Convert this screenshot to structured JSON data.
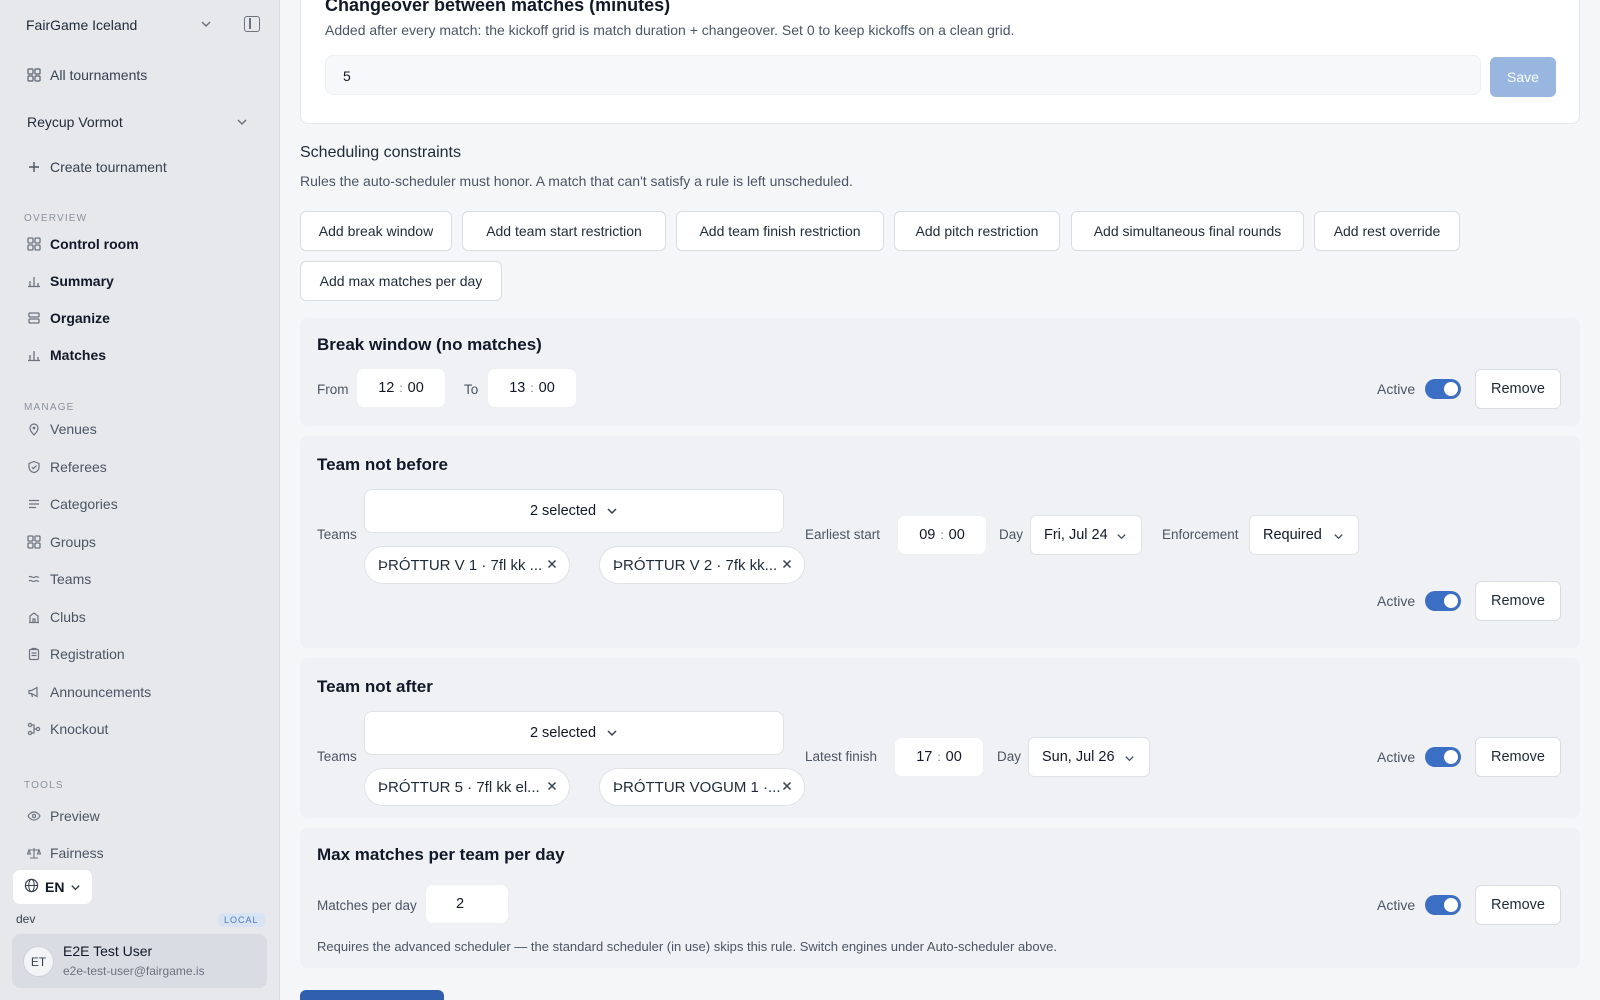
{
  "sidebar": {
    "org_name": "FairGame Iceland",
    "all_tournaments": "All tournaments",
    "tournament_name": "Reycup Vormot",
    "create_tournament": "Create tournament",
    "sections": {
      "overview": "OVERVIEW",
      "manage": "MANAGE",
      "tools": "TOOLS"
    },
    "overview_items": [
      {
        "label": "Control room",
        "icon": "grid-icon"
      },
      {
        "label": "Summary",
        "icon": "bar-chart-icon"
      },
      {
        "label": "Organize",
        "icon": "layers-icon"
      },
      {
        "label": "Matches",
        "icon": "bar-chart-icon"
      }
    ],
    "manage_items": [
      {
        "label": "Venues",
        "icon": "map-pin-icon"
      },
      {
        "label": "Referees",
        "icon": "shield-icon"
      },
      {
        "label": "Categories",
        "icon": "list-icon"
      },
      {
        "label": "Groups",
        "icon": "grid-icon"
      },
      {
        "label": "Teams",
        "icon": "users-icon"
      },
      {
        "label": "Clubs",
        "icon": "building-icon"
      },
      {
        "label": "Registration",
        "icon": "clipboard-icon"
      },
      {
        "label": "Announcements",
        "icon": "megaphone-icon"
      },
      {
        "label": "Knockout",
        "icon": "bracket-icon"
      }
    ],
    "tools_items": [
      {
        "label": "Preview",
        "icon": "eye-icon"
      },
      {
        "label": "Fairness",
        "icon": "scale-icon"
      }
    ],
    "language": "EN",
    "env": "dev",
    "env_badge": "LOCAL",
    "user": {
      "initials": "ET",
      "name": "E2E Test User",
      "email": "e2e-test-user@fairgame.is"
    }
  },
  "changeover": {
    "title": "Changeover between matches (minutes)",
    "description": "Added after every match: the kickoff grid is match duration + changeover. Set 0 to keep kickoffs on a clean grid.",
    "value": "5",
    "save_label": "Save"
  },
  "constraints": {
    "title": "Scheduling constraints",
    "description": "Rules the auto-scheduler must honor. A match that can't satisfy a rule is left unscheduled.",
    "add_buttons": [
      "Add break window",
      "Add team start restriction",
      "Add team finish restriction",
      "Add pitch restriction",
      "Add simultaneous final rounds",
      "Add rest override",
      "Add max matches per day"
    ]
  },
  "break_window": {
    "title": "Break window (no matches)",
    "from_label": "From",
    "from_h": "12",
    "from_m": "00",
    "to_label": "To",
    "to_h": "13",
    "to_m": "00",
    "active_label": "Active",
    "active": true,
    "remove_label": "Remove"
  },
  "team_not_before": {
    "title": "Team not before",
    "teams_label": "Teams",
    "selected": "2 selected",
    "chips": [
      "ÞRÓTTUR V 1 · 7fl kk ...",
      "ÞRÓTTUR V 2 · 7fk kk..."
    ],
    "earliest_label": "Earliest start",
    "time_h": "09",
    "time_m": "00",
    "day_label": "Day",
    "day": "Fri, Jul 24",
    "enforcement_label": "Enforcement",
    "enforcement": "Required",
    "active_label": "Active",
    "active": true,
    "remove_label": "Remove"
  },
  "team_not_after": {
    "title": "Team not after",
    "teams_label": "Teams",
    "selected": "2 selected",
    "chips": [
      "ÞRÓTTUR 5 · 7fl kk el...",
      "ÞRÓTTUR VOGUM 1 ·..."
    ],
    "latest_label": "Latest finish",
    "time_h": "17",
    "time_m": "00",
    "day_label": "Day",
    "day": "Sun, Jul 26",
    "active_label": "Active",
    "active": true,
    "remove_label": "Remove"
  },
  "max_matches": {
    "title": "Max matches per team per day",
    "per_day_label": "Matches per day",
    "value": "2",
    "active_label": "Active",
    "active": true,
    "remove_label": "Remove",
    "note": "Requires the advanced scheduler — the standard scheduler (in use) skips this rule. Switch engines under Auto-scheduler above."
  },
  "colors": {
    "accent": "#3a6fc4",
    "save_disabled": "#98b6df",
    "sidebar_bg": "#e6e8ec"
  }
}
